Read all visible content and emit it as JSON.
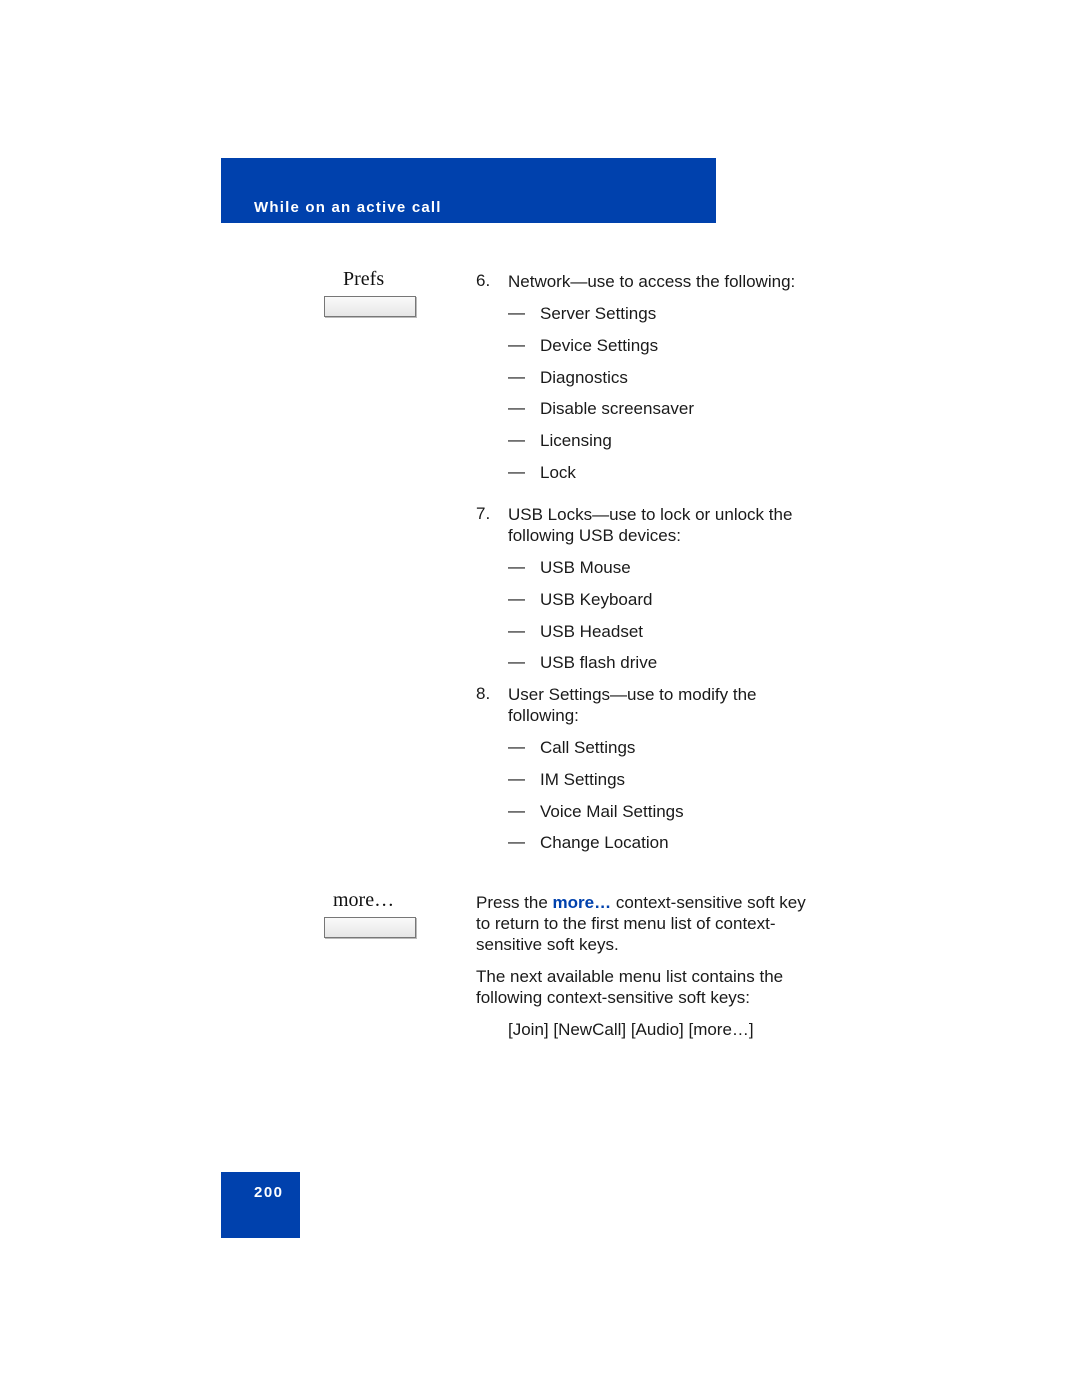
{
  "header": {
    "title": "While on an active call",
    "color": "#0041ad"
  },
  "softkeys": [
    {
      "label": "Prefs"
    },
    {
      "label": "more…"
    }
  ],
  "items": [
    {
      "number": "6.",
      "lines": [
        "Network—use to access the following:"
      ],
      "subitems": [
        "Server Settings",
        "Device Settings",
        "Diagnostics",
        "Disable screensaver",
        "Licensing",
        "Lock"
      ]
    },
    {
      "number": "7.",
      "lines": [
        "USB Locks—use to lock or unlock the",
        "following USB devices:"
      ],
      "subitems": [
        "USB Mouse",
        "USB Keyboard",
        "USB Headset",
        "USB flash drive"
      ]
    },
    {
      "number": "8.",
      "lines": [
        "User Settings—use to modify the",
        "following:"
      ],
      "subitems": [
        "Call Settings",
        "IM Settings",
        "Voice Mail Settings",
        "Change Location"
      ]
    }
  ],
  "dash": "—",
  "more_section": {
    "p1_prefix": "Press the ",
    "p1_highlight": "more…",
    "p1_suffix": " context-sensitive soft key",
    "p1_line2": "to return to the first menu list of context-",
    "p1_line3": "sensitive soft keys.",
    "p2_line1": "The next available menu list contains the",
    "p2_line2": "following context-sensitive soft keys:",
    "softkey_list": "[Join] [NewCall] [Audio] [more…]"
  },
  "page_number": "200"
}
